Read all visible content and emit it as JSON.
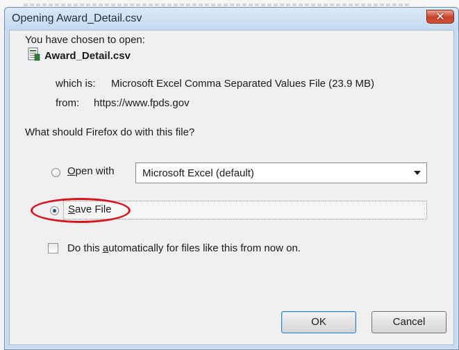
{
  "window": {
    "title": "Opening Award_Detail.csv",
    "close_glyph": "✕"
  },
  "intro": "You have chosen to open:",
  "file": {
    "name": "Award_Detail.csv",
    "icon": "csv-file-icon",
    "which_is_label": "which is:",
    "which_is_value": "Microsoft Excel Comma Separated Values File (23.9 MB)",
    "from_label": "from:",
    "from_value": "https://www.fpds.gov"
  },
  "question": "What should Firefox do with this file?",
  "options": {
    "open_with": {
      "label_first": "O",
      "label_rest": "pen with",
      "selected": false,
      "app_selected": "Microsoft Excel (default)"
    },
    "save_file": {
      "label_first": "S",
      "label_rest": "ave File",
      "selected": true
    }
  },
  "auto_checkbox": {
    "label_before": "Do this ",
    "label_accel": "a",
    "label_after": "utomatically for files like this from now on.",
    "checked": false
  },
  "buttons": {
    "ok": "OK",
    "cancel": "Cancel"
  },
  "colors": {
    "annotation": "#d9141c",
    "title_bar": "#c6d9ee",
    "close_button": "#c9412b"
  }
}
